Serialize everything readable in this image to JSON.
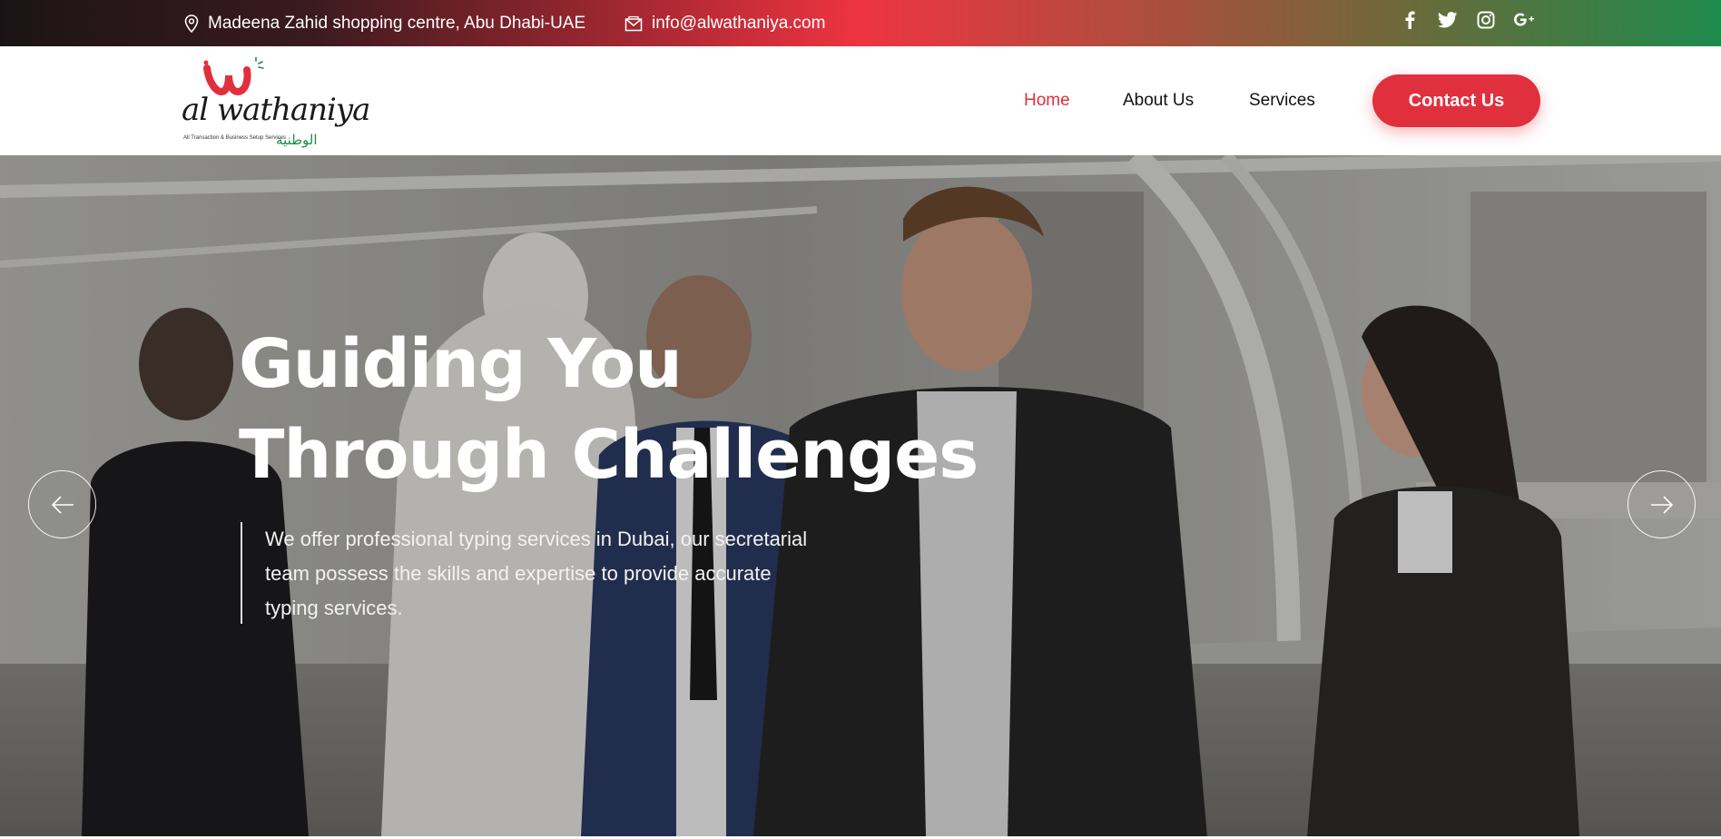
{
  "topbar": {
    "address": "Madeena Zahid shopping centre, Abu Dhabi-UAE",
    "email": "info@alwathaniya.com",
    "icons": {
      "address": "location-pin-icon",
      "email": "envelope-icon"
    },
    "socials": [
      {
        "name": "facebook-icon",
        "glyph": "f"
      },
      {
        "name": "twitter-icon",
        "glyph": "t"
      },
      {
        "name": "instagram-icon",
        "glyph": "ig"
      },
      {
        "name": "google-plus-icon",
        "glyph": "g+"
      }
    ]
  },
  "header": {
    "logo": {
      "main": "al wathaniya",
      "tagline": "All Transaction & Business Setup Services",
      "arabic": "الوطنية"
    },
    "nav": {
      "home": "Home",
      "about": "About Us",
      "services": "Services"
    },
    "cta": "Contact Us"
  },
  "hero": {
    "title_line1": "Guiding You",
    "title_line2": "Through Challenges",
    "description": "We offer professional typing services in Dubai, our secretarial team possess the skills and expertise to provide accurate typing services.",
    "prev_icon": "arrow-left-icon",
    "next_icon": "arrow-right-icon"
  },
  "colors": {
    "accent": "#e1303d",
    "arabic_green": "#1f8a4c",
    "nav_text": "#111111"
  }
}
